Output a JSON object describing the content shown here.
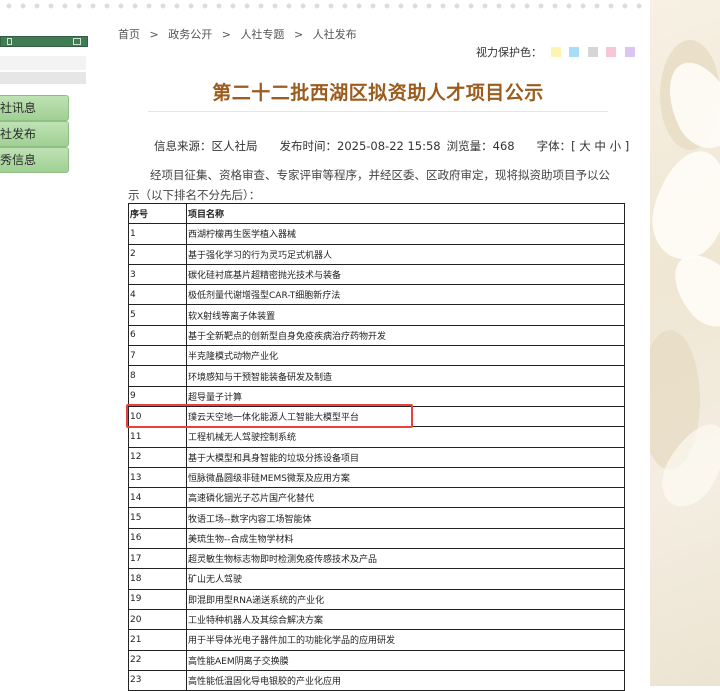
{
  "sidebar": {
    "items": [
      {
        "label": "社讯息"
      },
      {
        "label": "社发布"
      },
      {
        "label": "秀信息"
      }
    ]
  },
  "breadcrumb": [
    "首页",
    ">",
    "政务公开",
    ">",
    "人社专题",
    ">",
    "人社发布"
  ],
  "eye_protection": {
    "label": "视力保护色：",
    "swatches": [
      "#fff3b0",
      "#a9dcf6",
      "#d6d6d6",
      "#f7c6d9",
      "#d9c6f2"
    ]
  },
  "article": {
    "title": "第二十二批西湖区拟资助人才项目公示",
    "source": "信息来源：区人社局",
    "publish_time": "发布时间：2025-08-22 15:58",
    "views": "浏览量：468",
    "font_label": "字体：[",
    "font_large": "大",
    "font_mid": "中",
    "font_small": "小",
    "font_close": "]",
    "intro": "经项目征集、资格审查、专家评审等程序，并经区委、区政府审定，现将拟资助项目予以公示（以下排名不分先后）："
  },
  "table": {
    "headers": [
      "序号",
      "项目名称"
    ],
    "rows": [
      [
        "1",
        "西湖柠檬再生医学植入器械"
      ],
      [
        "2",
        "基于强化学习的行为灵巧足式机器人"
      ],
      [
        "3",
        "碳化硅衬底基片超精密抛光技术与装备"
      ],
      [
        "4",
        "极低剂量代谢增强型CAR-T细胞新疗法"
      ],
      [
        "5",
        "软X射线等离子体装置"
      ],
      [
        "6",
        "基于全新靶点的创新型自身免疫疾病治疗药物开发"
      ],
      [
        "7",
        "半克隆模式动物产业化"
      ],
      [
        "8",
        "环境感知与干预智能装备研发及制造"
      ],
      [
        "9",
        "超导量子计算"
      ],
      [
        "10",
        "璞云天空地一体化能源人工智能大模型平台"
      ],
      [
        "11",
        "工程机械无人驾驶控制系统"
      ],
      [
        "12",
        "基于大模型和具身智能的垃圾分拣设备项目"
      ],
      [
        "13",
        "恒脉微晶圆级非硅MEMS微泵及应用方案"
      ],
      [
        "14",
        "高速磷化铟光子芯片国产化替代"
      ],
      [
        "15",
        "牧语工场--数字内容工场智能体"
      ],
      [
        "16",
        "美琉生物--合成生物学材料"
      ],
      [
        "17",
        "超灵敏生物标志物即时检测免疫传感技术及产品"
      ],
      [
        "18",
        "矿山无人驾驶"
      ],
      [
        "19",
        "即混即用型RNA递送系统的产业化"
      ],
      [
        "20",
        "工业特种机器人及其综合解决方案"
      ],
      [
        "21",
        "用于半导体光电子器件加工的功能化学品的应用研发"
      ],
      [
        "22",
        "高性能AEM阴离子交换膜"
      ],
      [
        "23",
        "高性能低温固化导电银胶的产业化应用"
      ]
    ]
  },
  "colors": {
    "title": "#9b5c1d",
    "sidebar_green": "#3f7b55",
    "sidebar_item": "#bfe2b4",
    "highlight": "#e8413f"
  }
}
